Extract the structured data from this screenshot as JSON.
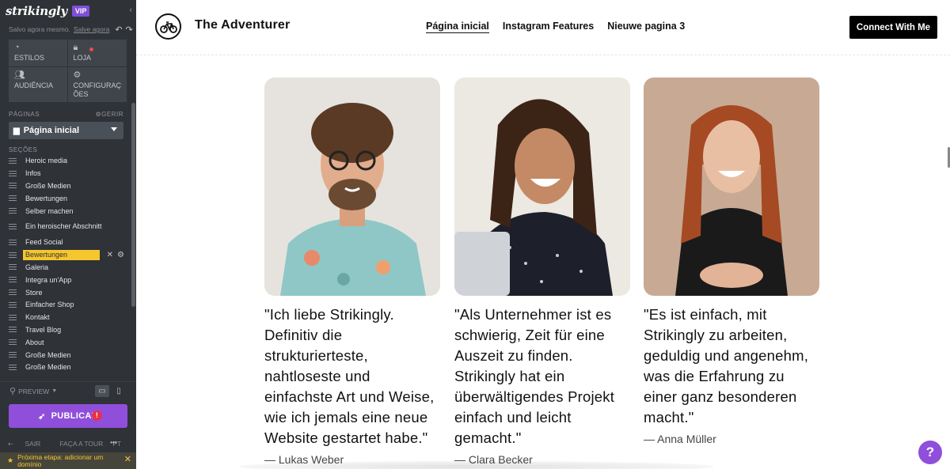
{
  "editor": {
    "logo": "strikingly",
    "badge": "VIP",
    "collapse_icon": "chevron-left-icon",
    "saved_text": "Salvo agora mesmo.",
    "save_link": "Salve agora",
    "tiles": [
      {
        "label": "ESTILOS",
        "icon": "palette-icon",
        "glyph": "◔"
      },
      {
        "label": "LOJA",
        "icon": "lock-icon",
        "glyph": "🔒︎"
      },
      {
        "label": "AUDIÊNCIA",
        "icon": "users-icon",
        "glyph": "👥︎"
      },
      {
        "label": "CONFIGURAÇ ÕES",
        "icon": "gear-icon",
        "glyph": "⚙"
      }
    ],
    "pages_label": "PÁGINAS",
    "manage_label": "GERIR",
    "current_page": "Página inicial",
    "sections_label": "SEÇÕES",
    "sections": [
      "Heroic media",
      "Infos",
      "Große Medien",
      "Bewertungen",
      "Selber machen",
      "Ein heroischer Abschnitt",
      "Feed Social",
      "Bewertungen",
      "Galeria",
      "Integra un'App",
      "Store",
      "Einfacher Shop",
      "Kontakt",
      "Travel Blog",
      "About",
      "Große Medien",
      "Große Medien"
    ],
    "active_section_index": 7,
    "preview_label": "PREVIEW",
    "publish_label": "PUBLICAR",
    "publish_alert": "!",
    "footer": {
      "exit": "SAIR",
      "tour": "FAÇA A TOUR",
      "lang": "PT",
      "more": "•••"
    },
    "next_step": "Próxima etapa: adicionar um domínio"
  },
  "site": {
    "brand": "The Adventurer",
    "nav": [
      "Página inicial",
      "Instagram Features",
      "Nieuwe pagina 3"
    ],
    "cta": "Connect With Me",
    "help": "?",
    "testimonials": [
      {
        "quote": "\"Ich liebe Strikingly. Definitiv die strukturierteste, nahtloseste und einfachste Art und Weise, wie ich jemals eine neue Website gestartet habe.\"",
        "author": "— Lukas Weber"
      },
      {
        "quote": "\"Als Unternehmer ist es schwierig, Zeit für eine Auszeit zu finden. Strikingly hat ein überwältigendes Projekt einfach und leicht gemacht.\"",
        "author": "— Clara Becker"
      },
      {
        "quote": "\"Es ist einfach, mit Strikingly zu arbeiten, geduldig und angenehm, was die Erfahrung zu einer ganz besonderen macht.\"",
        "author": "— Anna Müller"
      }
    ]
  }
}
